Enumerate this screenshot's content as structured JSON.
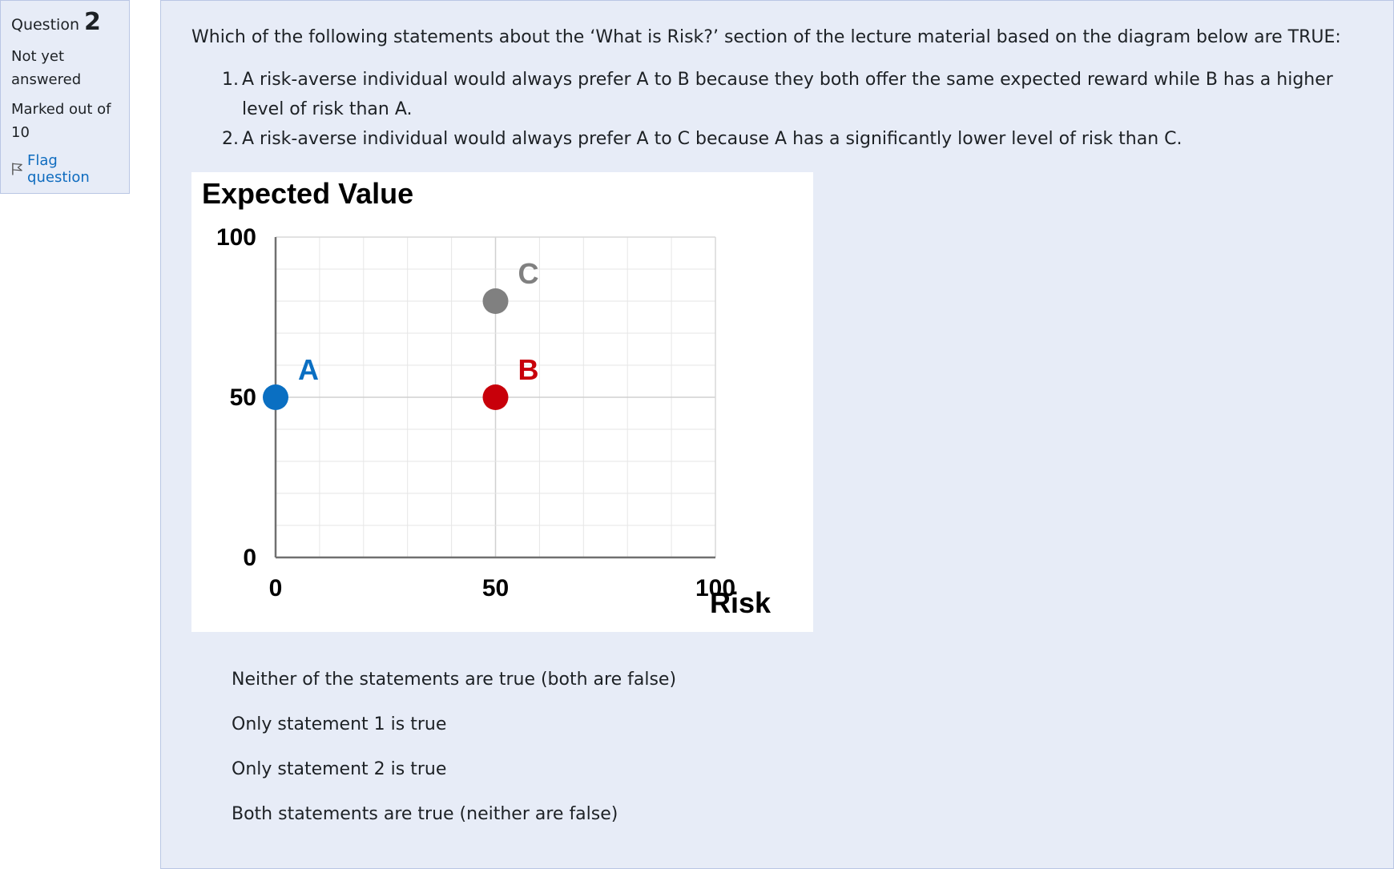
{
  "info": {
    "question_word": "Question",
    "question_number": "2",
    "state": "Not yet answered",
    "grade": "Marked out of 10",
    "flag_label": "Flag question"
  },
  "question": {
    "text": "Which of the following statements about the ‘What is Risk?’ section of the lecture material based on the diagram below are TRUE:",
    "statements": [
      {
        "num": "1.",
        "text": "A risk-averse individual would always prefer A to B because they both offer the same expected reward while B has a higher level of risk than A."
      },
      {
        "num": "2.",
        "text": "A risk-averse individual would always prefer A to C because A has a significantly lower level of risk than C."
      }
    ]
  },
  "chart_data": {
    "type": "scatter",
    "title": "Expected Value",
    "xlabel": "Risk",
    "ylabel": "",
    "xlim": [
      0,
      100
    ],
    "ylim": [
      0,
      100
    ],
    "x_ticks": [
      "0",
      "50",
      "100"
    ],
    "y_ticks": [
      "0",
      "50",
      "100"
    ],
    "grid": true,
    "points": [
      {
        "label": "A",
        "x": 0,
        "y": 50,
        "color": "#0a6fc2"
      },
      {
        "label": "B",
        "x": 50,
        "y": 50,
        "color": "#c8000a"
      },
      {
        "label": "C",
        "x": 50,
        "y": 80,
        "color": "#808080"
      }
    ]
  },
  "answers": [
    "Neither of the statements are true (both are false)",
    "Only statement 1 is true",
    "Only statement 2 is true",
    "Both statements are true (neither are false)"
  ]
}
